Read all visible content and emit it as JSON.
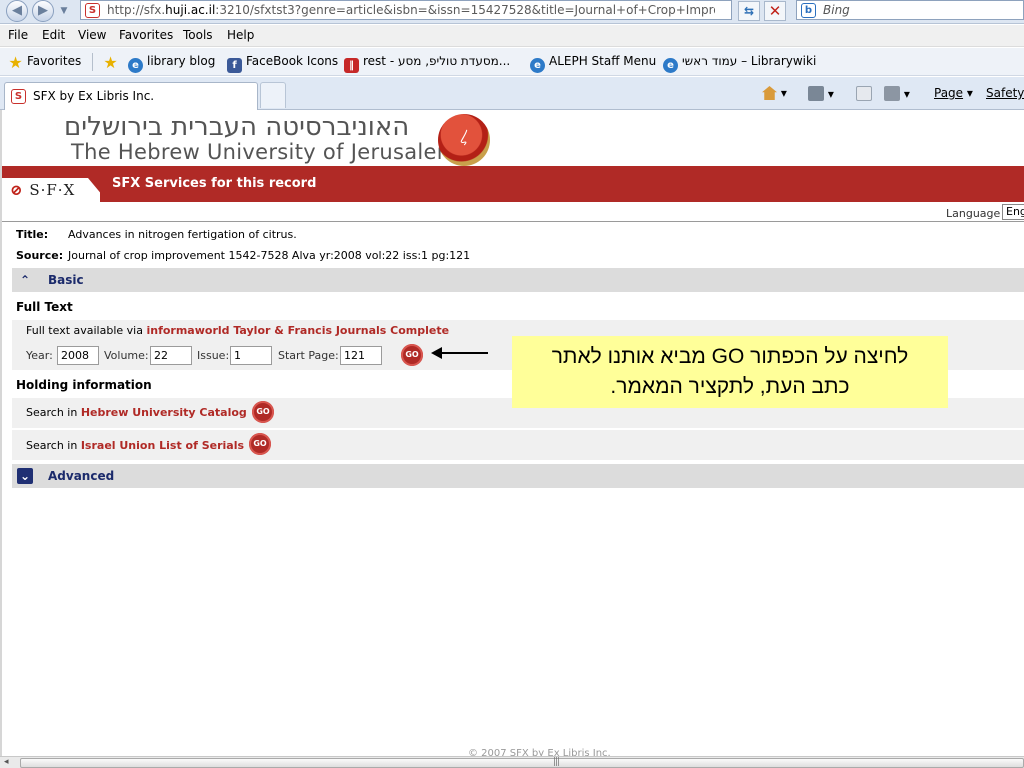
{
  "browser": {
    "url_prefix": "http://sfx.",
    "url_host": "huji.ac.il",
    "url_rest": ":3210/sfxtst3?genre=article&isbn=&issn=15427528&title=Journal+of+Crop+Improvemen",
    "search_placeholder": "Bing",
    "menu": [
      "File",
      "Edit",
      "View",
      "Favorites",
      "Tools",
      "Help"
    ],
    "favorites_label": "Favorites",
    "favorites": [
      {
        "label": "library blog",
        "icon": "ie-icon"
      },
      {
        "label": "FaceBook Icons",
        "icon": "facebook-icon"
      },
      {
        "label": "rest - מסעדת טוליפ, מסע...",
        "icon": "rest-icon"
      },
      {
        "label": "ALEPH Staff Menu",
        "icon": "ie-icon"
      },
      {
        "label": "עמוד ראשי – Librarywiki",
        "icon": "ie-icon"
      }
    ],
    "tab_title": "SFX by Ex Libris Inc.",
    "commands": {
      "page": "Page",
      "safety": "Safety"
    }
  },
  "header": {
    "university_hebrew": "האוניברסיטה העברית בירושלים",
    "university_english": "The Hebrew University of Jerusalem",
    "sfx_logo": "S·F·X",
    "services_title": "SFX Services for this record",
    "language_label": "Language",
    "language_value": "English"
  },
  "record": {
    "title_label": "Title:",
    "title_value": "Advances in nitrogen fertigation of citrus.",
    "source_label": "Source:",
    "source_value": "Journal of crop improvement 1542-7528 Alva yr:2008 vol:22 iss:1 pg:121"
  },
  "sections": {
    "basic": "Basic",
    "full_text": "Full Text",
    "full_text_prefix": "Full text available via",
    "full_text_source": "informaworld Taylor & Francis Journals Complete",
    "year_label": "Year:",
    "year_value": "2008",
    "volume_label": "Volume:",
    "volume_value": "22",
    "issue_label": "Issue:",
    "issue_value": "1",
    "start_page_label": "Start Page:",
    "start_page_value": "121",
    "go": "GO",
    "holding": "Holding information",
    "search_in": "Search in",
    "catalog": "Hebrew University Catalog",
    "union_list": "Israel Union List of Serials",
    "advanced": "Advanced"
  },
  "callout": {
    "line1": "לחיצה על הכפתור GO מביא אותנו לאתר",
    "line2": "כתב העת, לתקציר המאמר."
  },
  "footer": "© 2007 SFX by Ex Libris Inc.",
  "colors": {
    "brand_red": "#b02a26",
    "callout_yellow": "#ffff99",
    "section_navy": "#1b2a6b"
  }
}
